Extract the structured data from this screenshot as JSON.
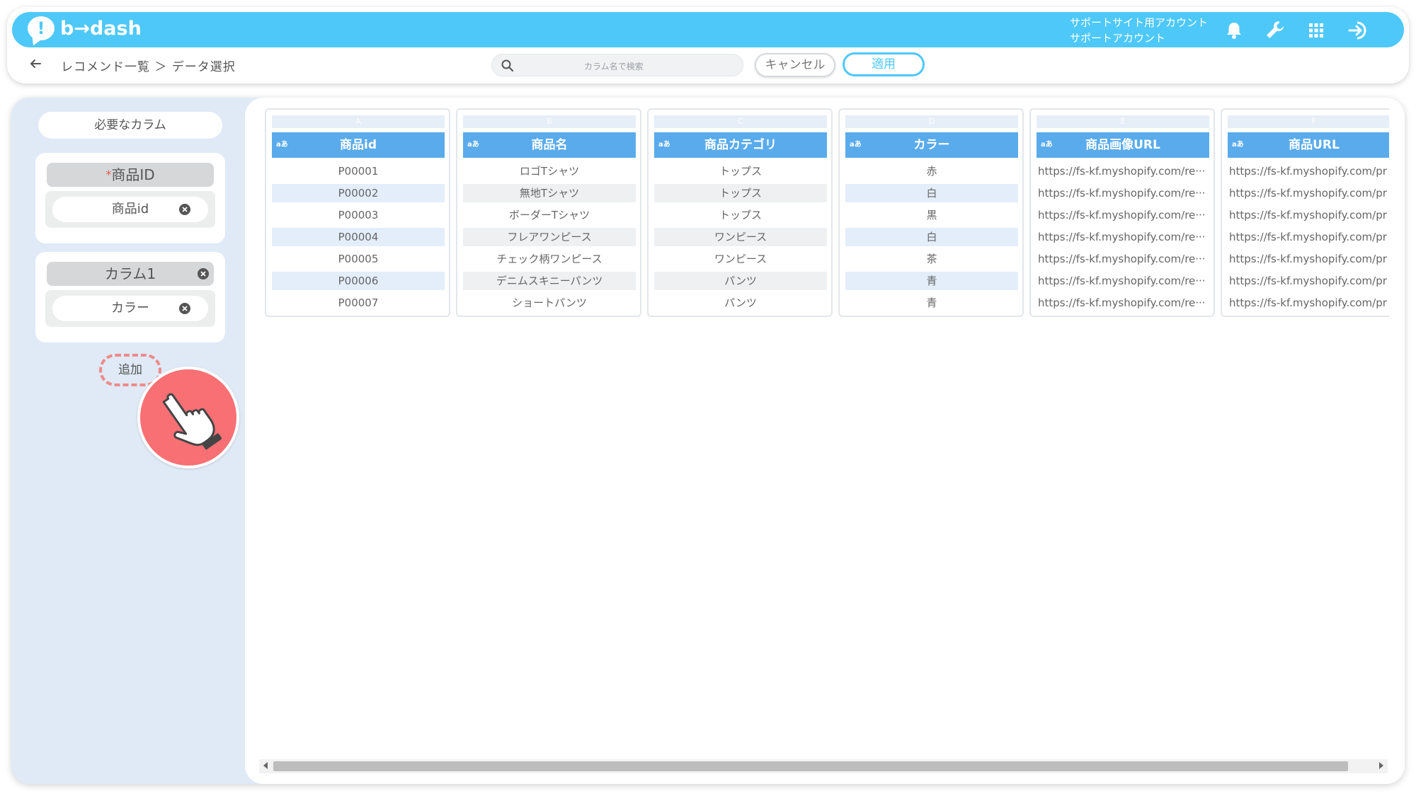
{
  "header": {
    "logo_text": "b→dash",
    "account_line1": "サポートサイト用アカウント",
    "account_line2": "サポートアカウント",
    "icons": [
      "bell-icon",
      "wrench-icon",
      "grid-icon",
      "logout-icon"
    ],
    "brand_color": "#4ec8f8"
  },
  "toolbar": {
    "breadcrumb": "レコメンド一覧 ＞ データ選択",
    "search_placeholder": "カラム名で検索",
    "cancel_label": "キャンセル",
    "apply_label": "適用"
  },
  "sidebar": {
    "title": "必要なカラム",
    "fields": [
      {
        "label": "商品ID",
        "required": true,
        "required_mark": "*",
        "value": "商品id"
      },
      {
        "label": "カラム1",
        "required": false,
        "value": "カラー"
      }
    ],
    "add_label": "追加"
  },
  "table": {
    "type_badge": "aあ",
    "columns": [
      {
        "letter": "A",
        "name": "商品id",
        "rows": [
          "P00001",
          "P00002",
          "P00003",
          "P00004",
          "P00005",
          "P00006",
          "P00007"
        ]
      },
      {
        "letter": "B",
        "name": "商品名",
        "rows": [
          "ロゴTシャツ",
          "無地Tシャツ",
          "ボーダーTシャツ",
          "フレアワンピース",
          "チェック柄ワンピース",
          "デニムスキニーパンツ",
          "ショートパンツ"
        ]
      },
      {
        "letter": "C",
        "name": "商品カテゴリ",
        "rows": [
          "トップス",
          "トップス",
          "トップス",
          "ワンピース",
          "ワンピース",
          "パンツ",
          "パンツ"
        ]
      },
      {
        "letter": "D",
        "name": "カラー",
        "rows": [
          "赤",
          "白",
          "黒",
          "白",
          "茶",
          "青",
          "青"
        ]
      },
      {
        "letter": "E",
        "name": "商品画像URL",
        "rows": [
          "https://fs-kf.myshopify.com/re···",
          "https://fs-kf.myshopify.com/re···",
          "https://fs-kf.myshopify.com/re···",
          "https://fs-kf.myshopify.com/re···",
          "https://fs-kf.myshopify.com/re···",
          "https://fs-kf.myshopify.com/re···",
          "https://fs-kf.myshopify.com/re···"
        ]
      },
      {
        "letter": "F",
        "name": "商品URL",
        "rows": [
          "https://fs-kf.myshopify.com/pr",
          "https://fs-kf.myshopify.com/pr",
          "https://fs-kf.myshopify.com/pr",
          "https://fs-kf.myshopify.com/pr",
          "https://fs-kf.myshopify.com/pr",
          "https://fs-kf.myshopify.com/pr",
          "https://fs-kf.myshopify.com/pr"
        ]
      }
    ]
  }
}
